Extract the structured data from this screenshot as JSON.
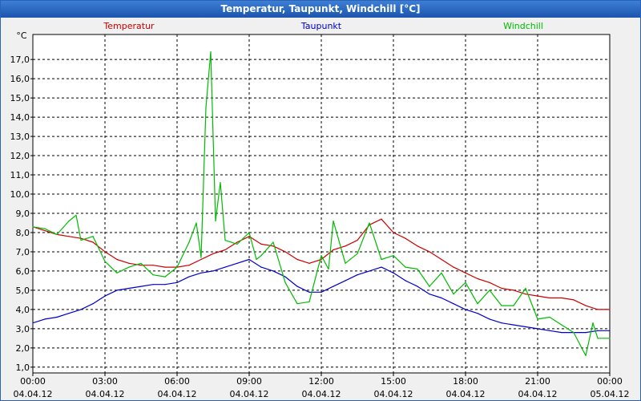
{
  "window": {
    "title": "Temperatur, Taupunkt, Windchill [°C]"
  },
  "chart_data": {
    "type": "line",
    "title": "Temperatur, Taupunkt, Windchill [°C]",
    "ylabel": "°C",
    "xlabel": "",
    "ylim": [
      0.7,
      18.3
    ],
    "xlim": [
      0,
      24
    ],
    "grid": true,
    "legend_placement": "top",
    "y_ticks": [
      "1,0",
      "2,0",
      "3,0",
      "4,0",
      "5,0",
      "6,0",
      "7,0",
      "8,0",
      "9,0",
      "10,0",
      "11,0",
      "12,0",
      "13,0",
      "14,0",
      "15,0",
      "16,0",
      "17,0"
    ],
    "x_ticks": [
      {
        "time": "00:00",
        "date": "04.04.12"
      },
      {
        "time": "03:00",
        "date": "04.04.12"
      },
      {
        "time": "06:00",
        "date": "04.04.12"
      },
      {
        "time": "09:00",
        "date": "04.04.12"
      },
      {
        "time": "12:00",
        "date": "04.04.12"
      },
      {
        "time": "15:00",
        "date": "04.04.12"
      },
      {
        "time": "18:00",
        "date": "04.04.12"
      },
      {
        "time": "21:00",
        "date": "04.04.12"
      },
      {
        "time": "00:00",
        "date": "05.04.12"
      }
    ],
    "series": [
      {
        "name": "Temperatur",
        "color": "#cc0000",
        "x": [
          0,
          0.5,
          1,
          1.5,
          2,
          2.5,
          3,
          3.5,
          4,
          4.5,
          5,
          5.5,
          6,
          6.5,
          7,
          7.5,
          8,
          8.5,
          9,
          9.5,
          10,
          10.5,
          11,
          11.5,
          12,
          12.5,
          13,
          13.5,
          14,
          14.5,
          15,
          15.5,
          16,
          16.5,
          17,
          17.5,
          18,
          18.5,
          19,
          19.5,
          20,
          20.5,
          21,
          21.5,
          22,
          22.5,
          23,
          23.5,
          24
        ],
        "values": [
          8.3,
          8.1,
          7.9,
          7.8,
          7.7,
          7.5,
          7.0,
          6.6,
          6.4,
          6.3,
          6.3,
          6.2,
          6.2,
          6.3,
          6.6,
          6.9,
          7.1,
          7.5,
          7.8,
          7.4,
          7.3,
          7.0,
          6.6,
          6.4,
          6.6,
          7.1,
          7.3,
          7.6,
          8.4,
          8.7,
          8.0,
          7.7,
          7.3,
          7.0,
          6.6,
          6.2,
          5.9,
          5.6,
          5.4,
          5.1,
          5.0,
          4.8,
          4.7,
          4.6,
          4.6,
          4.5,
          4.2,
          4.0,
          4.0
        ]
      },
      {
        "name": "Taupunkt",
        "color": "#0000cc",
        "x": [
          0,
          0.5,
          1,
          1.5,
          2,
          2.5,
          3,
          3.5,
          4,
          4.5,
          5,
          5.5,
          6,
          6.5,
          7,
          7.5,
          8,
          8.5,
          9,
          9.5,
          10,
          10.5,
          11,
          11.5,
          12,
          12.5,
          13,
          13.5,
          14,
          14.5,
          15,
          15.5,
          16,
          16.5,
          17,
          17.5,
          18,
          18.5,
          19,
          19.5,
          20,
          20.5,
          21,
          21.5,
          22,
          22.5,
          23,
          23.5,
          24
        ],
        "values": [
          3.3,
          3.5,
          3.6,
          3.8,
          4.0,
          4.3,
          4.7,
          5.0,
          5.1,
          5.2,
          5.3,
          5.3,
          5.4,
          5.7,
          5.9,
          6.0,
          6.2,
          6.4,
          6.6,
          6.2,
          6.0,
          5.7,
          5.2,
          4.9,
          4.9,
          5.2,
          5.5,
          5.8,
          6.0,
          6.2,
          5.9,
          5.5,
          5.2,
          4.8,
          4.6,
          4.3,
          4.0,
          3.8,
          3.5,
          3.3,
          3.2,
          3.1,
          3.0,
          2.9,
          2.8,
          2.8,
          2.8,
          2.9,
          2.9
        ]
      },
      {
        "name": "Windchill",
        "color": "#00bb00",
        "x": [
          0,
          0.5,
          1,
          1.5,
          1.8,
          2,
          2.5,
          3,
          3.5,
          4,
          4.5,
          5,
          5.5,
          6,
          6.5,
          6.8,
          7,
          7.2,
          7.4,
          7.6,
          7.8,
          8,
          8.5,
          9,
          9.3,
          9.5,
          10,
          10.5,
          11,
          11.5,
          12,
          12.3,
          12.5,
          13,
          13.5,
          14,
          14.5,
          15,
          15.5,
          16,
          16.5,
          17,
          17.5,
          18,
          18.5,
          19,
          19.5,
          20,
          20.5,
          21,
          21.5,
          22,
          22.5,
          23,
          23.3,
          23.5,
          24
        ],
        "values": [
          8.3,
          8.2,
          7.9,
          8.6,
          8.9,
          7.6,
          7.8,
          6.5,
          5.9,
          6.2,
          6.4,
          5.8,
          5.7,
          6.2,
          7.5,
          8.5,
          6.7,
          14.5,
          17.4,
          8.6,
          10.6,
          7.6,
          7.4,
          8.0,
          6.6,
          6.8,
          7.5,
          5.4,
          4.3,
          4.4,
          6.8,
          6.1,
          8.6,
          6.4,
          6.9,
          8.5,
          6.6,
          6.8,
          6.2,
          6.1,
          5.2,
          5.9,
          4.8,
          5.4,
          4.3,
          5.0,
          4.2,
          4.2,
          5.1,
          3.5,
          3.6,
          3.2,
          2.8,
          1.6,
          3.3,
          2.5,
          2.5
        ]
      }
    ]
  }
}
